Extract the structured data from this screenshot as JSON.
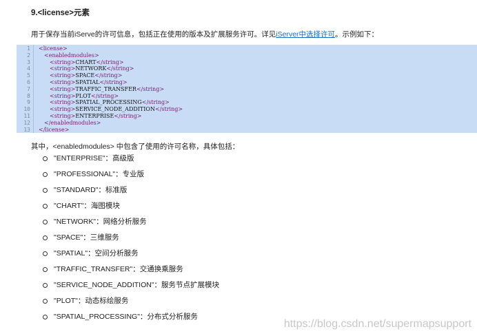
{
  "heading": "9.<license>元素",
  "intro": {
    "before": "用于保存当前iServe的许可信息，包括正在使用的版本及扩展服务许可。详见",
    "link": "iServer中选择许可",
    "after": "。示例如下："
  },
  "code_lines": [
    {
      "n": "1",
      "indent": 1,
      "parts": [
        {
          "t": "<license>",
          "c": "tag"
        }
      ]
    },
    {
      "n": "2",
      "indent": 2,
      "parts": [
        {
          "t": "<enabledmodules>",
          "c": "tag"
        }
      ]
    },
    {
      "n": "3",
      "indent": 3,
      "parts": [
        {
          "t": "<string>",
          "c": "tag"
        },
        {
          "t": "CHART",
          "c": "txt"
        },
        {
          "t": "</string>",
          "c": "tag"
        }
      ]
    },
    {
      "n": "4",
      "indent": 3,
      "parts": [
        {
          "t": "<string>",
          "c": "tag"
        },
        {
          "t": "NETWORK",
          "c": "txt"
        },
        {
          "t": "</string>",
          "c": "tag"
        }
      ]
    },
    {
      "n": "5",
      "indent": 3,
      "parts": [
        {
          "t": "<string>",
          "c": "tag"
        },
        {
          "t": "SPACE",
          "c": "txt"
        },
        {
          "t": "</string>",
          "c": "tag"
        }
      ]
    },
    {
      "n": "6",
      "indent": 3,
      "parts": [
        {
          "t": "<string>",
          "c": "tag"
        },
        {
          "t": "SPATIAL",
          "c": "txt"
        },
        {
          "t": "</string>",
          "c": "tag"
        }
      ]
    },
    {
      "n": "7",
      "indent": 3,
      "parts": [
        {
          "t": "<string>",
          "c": "tag"
        },
        {
          "t": "TRAFFIC_TRANSFER",
          "c": "txt"
        },
        {
          "t": "</string>",
          "c": "tag"
        }
      ]
    },
    {
      "n": "8",
      "indent": 3,
      "parts": [
        {
          "t": "<string>",
          "c": "tag"
        },
        {
          "t": "PLOT",
          "c": "txt"
        },
        {
          "t": "</string>",
          "c": "tag"
        }
      ]
    },
    {
      "n": "9",
      "indent": 3,
      "parts": [
        {
          "t": "<string>",
          "c": "tag"
        },
        {
          "t": "SPATIAL_PROCESSING",
          "c": "txt"
        },
        {
          "t": "</string>",
          "c": "tag"
        }
      ]
    },
    {
      "n": "10",
      "indent": 3,
      "parts": [
        {
          "t": "<string>",
          "c": "tag"
        },
        {
          "t": "SERVICE_NODE_ADDITION",
          "c": "txt"
        },
        {
          "t": "</string>",
          "c": "tag"
        }
      ]
    },
    {
      "n": "11",
      "indent": 3,
      "parts": [
        {
          "t": "<string>",
          "c": "tag"
        },
        {
          "t": "ENTERPRISE",
          "c": "txt"
        },
        {
          "t": "</string>",
          "c": "tag"
        }
      ]
    },
    {
      "n": "12",
      "indent": 2,
      "parts": [
        {
          "t": "</enabledmodules>",
          "c": "tag"
        }
      ]
    },
    {
      "n": "13",
      "indent": 1,
      "parts": [
        {
          "t": "</license>",
          "c": "tag"
        }
      ]
    }
  ],
  "modules_intro": "其中，<enabledmodules> 中包含了使用的许可名称，具体包括：",
  "modules": [
    "\"ENTERPRISE\"：高级版",
    "\"PROFESSIONAL\"：专业版",
    "\"STANDARD\"：标准版",
    "\"CHART\"：海图模块",
    "\"NETWORK\"：网络分析服务",
    "\"SPACE\"：三维服务",
    "\"SPATIAL\"：空间分析服务",
    "\"TRAFFIC_TRANSFER\"：交通换乘服务",
    "\"SERVICE_NODE_ADDITION\"：服务节点扩展模块",
    "\"PLOT\"：动态标绘服务",
    "\"SPATIAL_PROCESSING\"：分布式分析服务"
  ],
  "watermark": "https://blog.csdn.net/supermapsupport",
  "colors": {
    "code_bg": "#c8dcf6",
    "tag": "#7a1a6e",
    "link": "#1a6bbf"
  }
}
